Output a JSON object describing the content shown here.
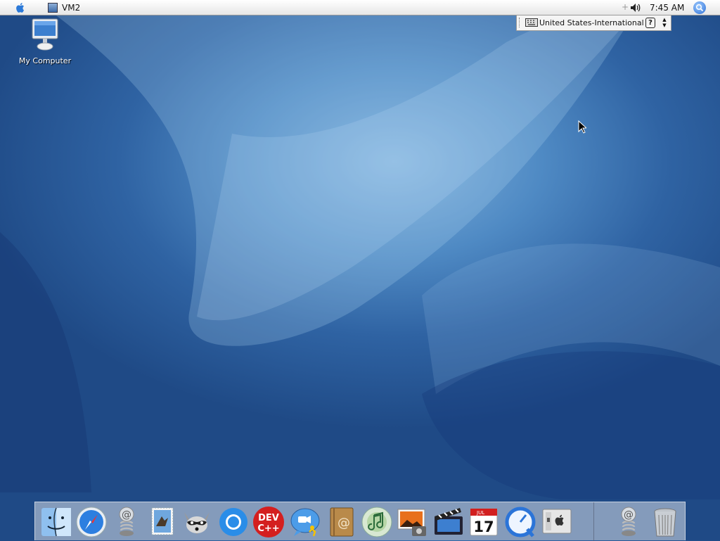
{
  "menubar": {
    "app_name": "VM2",
    "plus": "+",
    "clock": "7:45 AM"
  },
  "input_menu": {
    "label": "United States-International",
    "help": "?",
    "arrows": "▲▼"
  },
  "desktop": {
    "icon_label": "My Computer"
  },
  "dock": {
    "items": [
      "finder-icon",
      "safari-icon",
      "mail-spring-icon",
      "mail-stamp-icon",
      "raccoon-icon",
      "chrome-icon",
      "dev-cpp-icon",
      "ichat-icon",
      "address-book-icon",
      "itunes-icon",
      "iphoto-icon",
      "imovie-icon",
      "ical-icon",
      "quicktime-icon",
      "system-preferences-icon",
      "mail-spring-2-icon",
      "trash-icon"
    ],
    "dev_text_top": "DEV",
    "dev_text_bottom": "C++",
    "cal_month": "JUL",
    "cal_day": "17",
    "address_at": "@"
  },
  "colors": {
    "desktop_blue": "#2f63a3",
    "menubar": "#efefef",
    "dev_red": "#d41f1f"
  }
}
